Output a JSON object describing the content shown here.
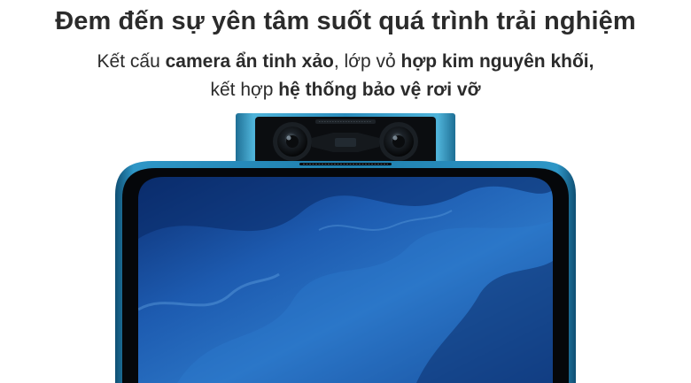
{
  "headline": "Đem đến sự yên tâm suốt quá trình trải nghiệm",
  "subtitle": {
    "line1": {
      "part1": "Kết cấu ",
      "bold1": "camera ẩn tinh xảo",
      "part2": ", lớp vỏ ",
      "bold2": "hợp kim nguyên khối,"
    },
    "line2": {
      "part1": "kết hợp ",
      "bold1": "hệ thống bảo vệ rơi vỡ"
    }
  },
  "colors": {
    "text": "#2b2b2b",
    "frame_blue": "#1f7fae",
    "screen_blue": "#1a4fa3",
    "bezel": "#050709"
  },
  "illustration": {
    "subject": "phone-with-pop-up-dual-camera",
    "icons": [
      "camera-lens-icon",
      "camera-lens-icon"
    ]
  }
}
